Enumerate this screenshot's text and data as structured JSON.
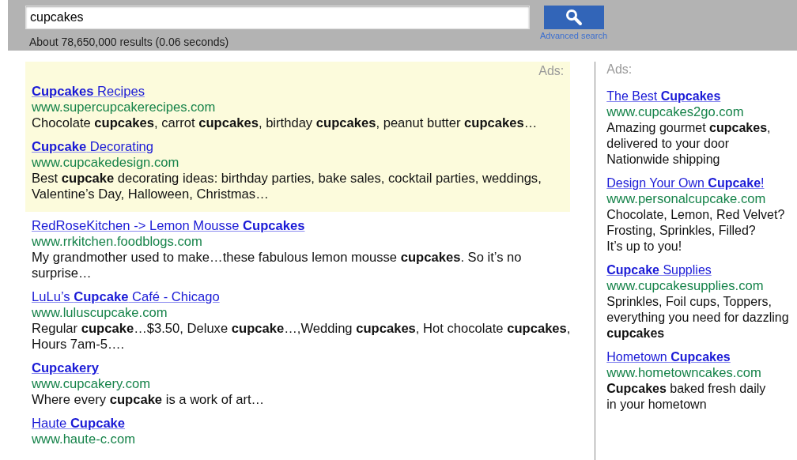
{
  "search": {
    "query": "cupcakes",
    "results_info": "About 78,650,000 results (0.06 seconds)",
    "advanced_link": "Advanced search"
  },
  "top_ads": {
    "label": "Ads:",
    "items": [
      {
        "title": "**Cupcakes** Recipes",
        "url": "www.supercupcakerecipes.com",
        "lines": [
          "Chocolate **cupcakes**, carrot **cupcakes**, birthday **cupcakes**, peanut butter **cupcakes**…"
        ]
      },
      {
        "title": "**Cupcake** Decorating",
        "url": "www.cupcakedesign.com",
        "lines": [
          "Best **cupcake** decorating ideas: birthday parties, bake sales, cocktail parties, weddings, Valentine’s Day, Halloween, Christmas…"
        ]
      }
    ]
  },
  "results": [
    {
      "title": "RedRoseKitchen -> Lemon Mousse **Cupcakes**",
      "url": "www.rrkitchen.foodblogs.com",
      "lines": [
        "My grandmother used to make…these fabulous lemon mousse **cupcakes**. So it’s no surprise…"
      ]
    },
    {
      "title": "LuLu’s **Cupcake** Café - Chicago",
      "url": "www.luluscupcake.com",
      "lines": [
        "Regular **cupcake**…$3.50, Deluxe **cupcake**…,Wedding **cupcakes**, Hot chocolate **cupcakes**, Hours 7am-5…."
      ]
    },
    {
      "title": "**Cupcakery**",
      "url": "www.cupcakery.com",
      "lines": [
        "Where every **cupcake** is a work of art…"
      ]
    },
    {
      "title": "Haute **Cupcake**",
      "url": "www.haute-c.com"
    }
  ],
  "side_ads": {
    "label": "Ads:",
    "items": [
      {
        "title": "The Best **Cupcakes**",
        "url": "www.cupcakes2go.com",
        "lines": [
          "Amazing gourmet **cupcakes**,",
          "delivered to your door",
          "Nationwide shipping"
        ]
      },
      {
        "title": "Design Your Own **Cupcake**!",
        "url": "www.personalcupcake.com",
        "lines": [
          "Chocolate, Lemon, Red Velvet?",
          "Frosting, Sprinkles, Filled?",
          "It’s up to you!"
        ]
      },
      {
        "title": "**Cupcake** Supplies",
        "url": "www.cupcakesupplies.com",
        "lines": [
          "Sprinkles, Foil cups, Toppers,",
          "everything you need for dazzling",
          "**cupcakes**"
        ]
      },
      {
        "title": "Hometown **Cupcakes**",
        "url": "www.hometowncakes.com",
        "lines": [
          "**Cupcakes** baked fresh daily",
          "in your hometown"
        ]
      }
    ]
  }
}
